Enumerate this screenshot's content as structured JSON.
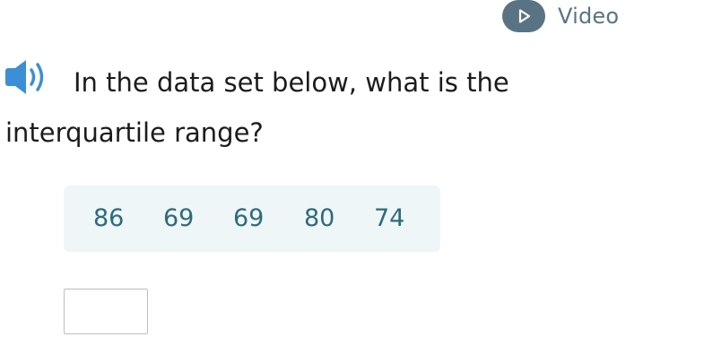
{
  "video": {
    "label": "Video",
    "icon": "play-icon",
    "color": "#5a7384"
  },
  "question": {
    "speaker_icon": "speaker-icon",
    "text": "In the data set below, what is the interquartile range?"
  },
  "data_set": {
    "values": [
      "86",
      "69",
      "69",
      "80",
      "74"
    ]
  },
  "answer": {
    "value": "",
    "placeholder": ""
  },
  "colors": {
    "accent": "#5a7384",
    "speaker": "#3c8fd6",
    "data_text": "#2e6a7a",
    "data_bg": "#eef6f8"
  }
}
